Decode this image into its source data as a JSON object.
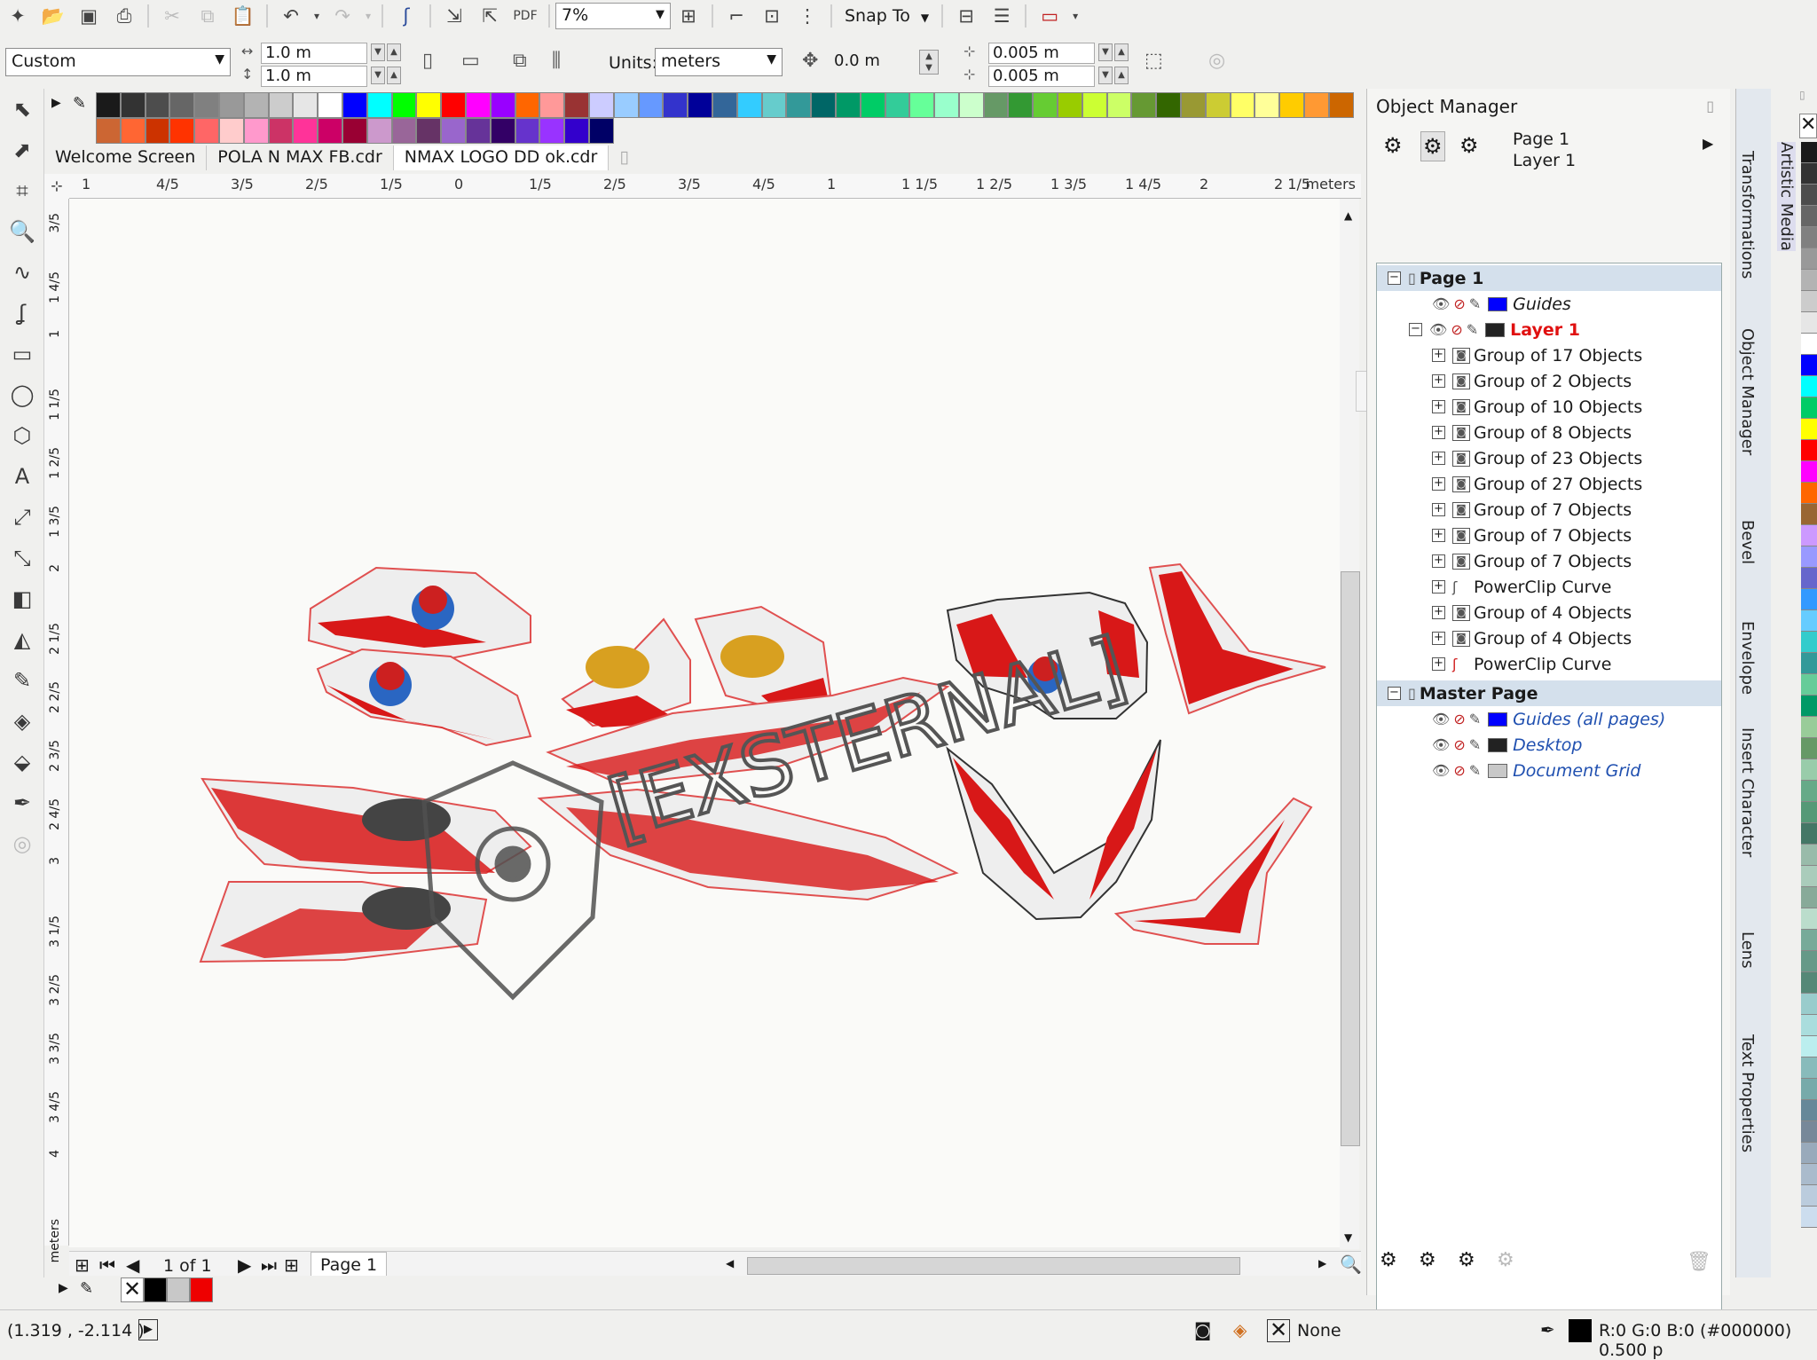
{
  "toolbar": {
    "zoom_value": "7%",
    "snap_label": "Snap To"
  },
  "property_bar": {
    "page_size": "Custom",
    "width": "1.0 m",
    "height": "1.0 m",
    "units_label": "Units:",
    "units": "meters",
    "nudge": "0.0 m",
    "dup_x": "0.005 m",
    "dup_y": "0.005 m"
  },
  "tabs": [
    {
      "label": "Welcome Screen"
    },
    {
      "label": "POLA N MAX FB.cdr"
    },
    {
      "label": "NMAX LOGO DD ok.cdr"
    }
  ],
  "ruler": {
    "h_ticks": [
      "1",
      "4/5",
      "3/5",
      "2/5",
      "1/5",
      "0",
      "1/5",
      "2/5",
      "3/5",
      "4/5",
      "1",
      "1 1/5",
      "1 2/5",
      "1 3/5",
      "1 4/5",
      "2",
      "2 1/5"
    ],
    "h_unit": "meters",
    "v_ticks": [
      "3/5",
      "1 4/5",
      "1",
      "1 1/5",
      "1 2/5",
      "1 3/5",
      "2",
      "2 1/5",
      "2 2/5",
      "2 3/5",
      "2 4/5",
      "3",
      "3 1/5",
      "3 2/5",
      "3 3/5",
      "3 4/5",
      "4"
    ],
    "v_unit": "meters"
  },
  "watermark": "[EXSTERNAL]",
  "page_nav": {
    "counter": "1 of 1",
    "page_tab": "Page 1"
  },
  "object_manager": {
    "title": "Object Manager",
    "current_page": "Page 1",
    "current_layer": "Layer 1",
    "page_label": "Page 1",
    "master_label": "Master Page",
    "page_layers": [
      {
        "label": "Guides",
        "color": "#0000ff"
      },
      {
        "label": "Layer 1",
        "color": "#222222"
      }
    ],
    "objects": [
      {
        "label": "Group of 17 Objects",
        "icon": "group"
      },
      {
        "label": "Group of 2 Objects",
        "icon": "group"
      },
      {
        "label": "Group of 10 Objects",
        "icon": "group"
      },
      {
        "label": "Group of 8 Objects",
        "icon": "group"
      },
      {
        "label": "Group of 23 Objects",
        "icon": "group"
      },
      {
        "label": "Group of 27 Objects",
        "icon": "group"
      },
      {
        "label": "Group of 7 Objects",
        "icon": "group"
      },
      {
        "label": "Group of 7 Objects",
        "icon": "group"
      },
      {
        "label": "Group of 7 Objects",
        "icon": "group"
      },
      {
        "label": "PowerClip Curve",
        "icon": "curve-black"
      },
      {
        "label": "Group of 4 Objects",
        "icon": "group"
      },
      {
        "label": "Group of 4 Objects",
        "icon": "group"
      },
      {
        "label": "PowerClip Curve",
        "icon": "curve-red"
      }
    ],
    "master_layers": [
      {
        "label": "Guides (all pages)",
        "color": "#0000ff"
      },
      {
        "label": "Desktop",
        "color": "#222222"
      },
      {
        "label": "Document Grid",
        "color": "#c8c8c8"
      }
    ]
  },
  "dockers": [
    "Artistic Media",
    "Transformations",
    "Object Manager",
    "Bevel",
    "Envelope",
    "Insert Character",
    "Lens",
    "Text Properties"
  ],
  "status": {
    "coords": "(1.319 , -2.114 )",
    "fill_label": "None",
    "outline_info": "R:0 G:0 B:0 (#000000)  0.500 p"
  },
  "palette_colors": [
    "#1a1a1a",
    "#333333",
    "#4d4d4d",
    "#666666",
    "#808080",
    "#999999",
    "#b3b3b3",
    "#cccccc",
    "#e6e6e6",
    "#ffffff",
    "#0000ff",
    "#00ffff",
    "#00ff00",
    "#ffff00",
    "#ff0000",
    "#ff00ff",
    "#9900ff",
    "#ff6600",
    "#ff9999",
    "#993333",
    "#ccccff",
    "#99ccff",
    "#6699ff",
    "#3333cc",
    "#000099",
    "#336699",
    "#33ccff",
    "#66cccc",
    "#339999",
    "#006666",
    "#009966",
    "#00cc66",
    "#33cc99",
    "#66ff99",
    "#99ffcc",
    "#ccffcc",
    "#669966",
    "#339933",
    "#66cc33",
    "#99cc00",
    "#ccff33",
    "#ccff66",
    "#669933",
    "#336600",
    "#999933",
    "#cccc33",
    "#ffff66",
    "#ffff99",
    "#ffcc00",
    "#ff9933",
    "#cc6600",
    "#cc6633",
    "#ff6633",
    "#cc3300",
    "#ff3300",
    "#ff6666",
    "#ffcccc",
    "#ff99cc",
    "#cc3366",
    "#ff3399",
    "#cc0066",
    "#990033",
    "#cc99cc",
    "#996699",
    "#663366",
    "#9966cc",
    "#663399",
    "#330066",
    "#6633cc",
    "#9933ff",
    "#3300cc",
    "#000066"
  ],
  "right_palette": [
    "#1a1a1a",
    "#333333",
    "#4d4d4d",
    "#666666",
    "#808080",
    "#999999",
    "#b3b3b3",
    "#cccccc",
    "#e6e6e6",
    "#ffffff",
    "#0000ff",
    "#00ffff",
    "#00cc66",
    "#ffff00",
    "#ff0000",
    "#ff00ff",
    "#ff6600",
    "#996633",
    "#cc99ff",
    "#9999ff",
    "#6666cc",
    "#3399ff",
    "#66ccff",
    "#33cccc",
    "#339999",
    "#66cc99",
    "#009966",
    "#99cc99",
    "#669966",
    "#99ccaa",
    "#66aa88",
    "#559977",
    "#447766",
    "#99bbaa",
    "#aaccbb",
    "#88aa99",
    "#bbddcc",
    "#77aa99",
    "#669988",
    "#558877",
    "#99cccc",
    "#aadddd",
    "#bbeeee",
    "#88bbbb",
    "#77aaaa",
    "#668899",
    "#778899",
    "#99aabb",
    "#aabbcc",
    "#bbccdd",
    "#ccddee"
  ]
}
